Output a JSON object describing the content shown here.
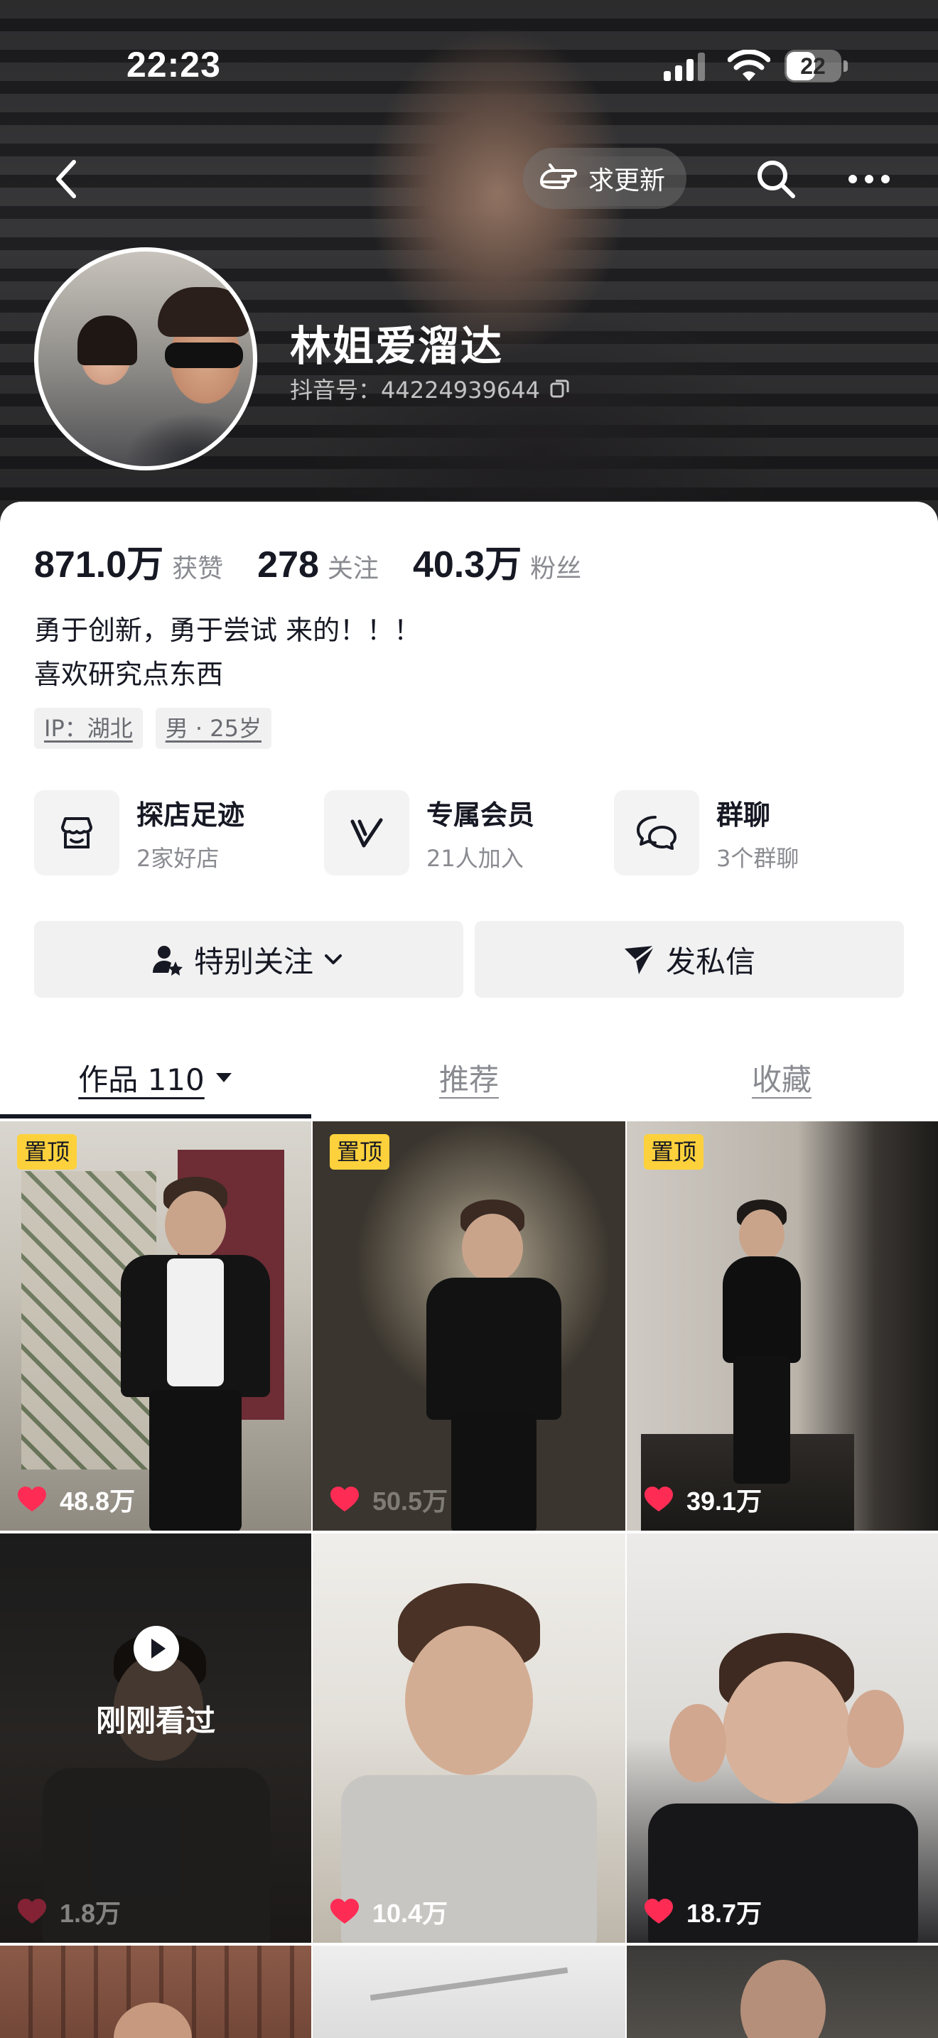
{
  "status": {
    "time": "22:23",
    "battery": "22"
  },
  "nav": {
    "request_update": "求更新"
  },
  "profile": {
    "name": "林姐爱溜达",
    "douyin_id": "抖音号：44224939644"
  },
  "stats": [
    {
      "value": "871.0万",
      "label": "获赞"
    },
    {
      "value": "278",
      "label": "关注"
    },
    {
      "value": "40.3万",
      "label": "粉丝"
    }
  ],
  "bio": {
    "line1": "勇于创新，勇于尝试   来的！！！",
    "line2": "喜欢研究点东西"
  },
  "tags": [
    "IP：湖北",
    "男 · 25岁"
  ],
  "features": [
    {
      "title": "探店足迹",
      "subtitle": "2家好店",
      "icon": "shop-icon"
    },
    {
      "title": "专属会员",
      "subtitle": "21人加入",
      "icon": "member-v-icon"
    },
    {
      "title": "群聊",
      "subtitle": "3个群聊",
      "icon": "chat-bubbles-icon"
    }
  ],
  "actions": {
    "follow": "特别关注",
    "message": "发私信"
  },
  "tabs": {
    "works": "作品 110",
    "recommend": "推荐",
    "favorites": "收藏"
  },
  "videos": [
    {
      "pinned": "置顶",
      "likes": "48.8万"
    },
    {
      "pinned": "置顶",
      "likes": "50.5万"
    },
    {
      "pinned": "置顶",
      "likes": "39.1万"
    },
    {
      "overlay": "刚刚看过",
      "likes": "1.8万"
    },
    {
      "likes": "10.4万"
    },
    {
      "likes": "18.7万"
    }
  ],
  "colors": {
    "pin_badge": "#fdd13c",
    "heart": "#fe2c55",
    "text_primary": "#161823",
    "text_secondary": "#8a8b91"
  }
}
